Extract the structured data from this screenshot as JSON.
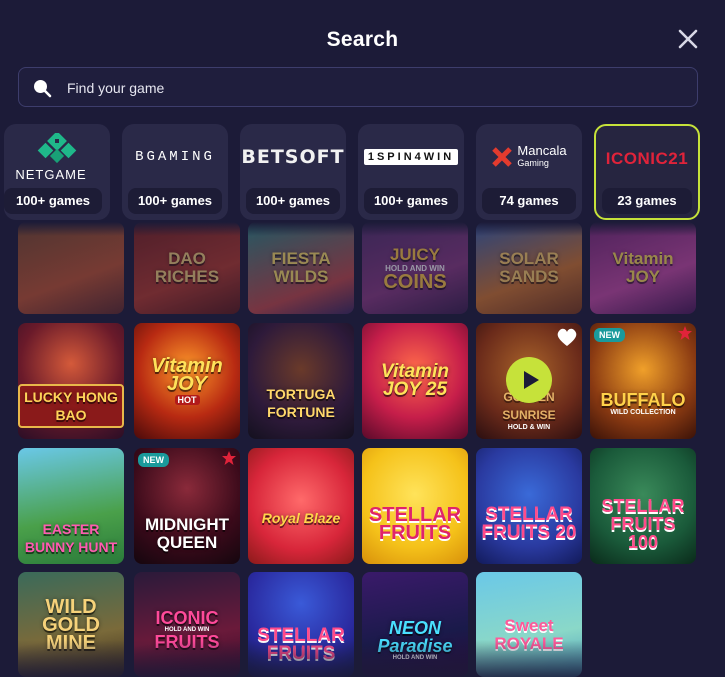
{
  "header": {
    "title": "Search",
    "close_icon": "close-icon"
  },
  "search": {
    "placeholder": "Find your game",
    "value": "",
    "icon": "search-icon"
  },
  "colors": {
    "background": "#1c1b38",
    "accent": "#c6e23a",
    "play": "#c6e23a",
    "new_badge": "#1a9a9b"
  },
  "providers": [
    {
      "name": "NETGAME",
      "count": "100+ games",
      "active": false
    },
    {
      "name": "BGAMING",
      "count": "100+ games",
      "active": false
    },
    {
      "name": "BETSOFT",
      "count": "100+ games",
      "active": false
    },
    {
      "name": "1SPIN4WIN",
      "count": "100+ games",
      "active": false
    },
    {
      "name": "Mancala",
      "sub": "Gaming",
      "count": "74 games",
      "active": false
    },
    {
      "name": "ICONIC21",
      "count": "23 games",
      "active": true
    }
  ],
  "games": [
    {
      "name": "",
      "new": false
    },
    {
      "name": "DAO RICHES",
      "new": false
    },
    {
      "name": "FIESTA WILDS",
      "new": false
    },
    {
      "name": "JUICY",
      "sub": "HOLD AND WIN",
      "name2": "COINS",
      "new": false
    },
    {
      "name": "SOLAR SANDS",
      "new": false
    },
    {
      "name": "Vitamin JOY",
      "new": false
    },
    {
      "name": "LUCKY HONG BAO",
      "new": false
    },
    {
      "name": "Vitamin JOY",
      "sub": "HOT",
      "new": false
    },
    {
      "name": "TORTUGA FORTUNE",
      "new": false
    },
    {
      "name": "Vitamin JOY 25",
      "new": false
    },
    {
      "name": "GOLDEN SUNRISE",
      "sub": "HOLD & WIN",
      "new": false,
      "hovered": true
    },
    {
      "name": "BUFFALO",
      "sub": "WILD COLLECTION",
      "new": true,
      "badge": "NEW"
    },
    {
      "name": "EASTER BUNNY HUNT",
      "new": false
    },
    {
      "name": "MIDNIGHT QUEEN",
      "new": true,
      "badge": "NEW"
    },
    {
      "name": "Royal Blaze",
      "new": false
    },
    {
      "name": "STELLAR FRUITS",
      "new": false
    },
    {
      "name": "STELLAR FRUITS 20",
      "new": false
    },
    {
      "name": "STELLAR FRUITS 100",
      "new": false
    },
    {
      "name": "WILD GOLD MINE",
      "new": false
    },
    {
      "name": "ICONIC",
      "sub": "HOLD AND WIN",
      "name2": "FRUITS",
      "new": false
    },
    {
      "name": "STELLAR FRUITS",
      "new": false
    },
    {
      "name": "NEON Paradise",
      "sub": "HOLD AND WIN",
      "new": false
    },
    {
      "name": "Sweet ROYALE",
      "new": false
    }
  ]
}
